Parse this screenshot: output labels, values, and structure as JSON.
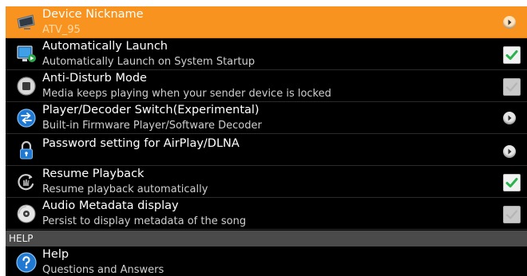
{
  "accent_color": "#f7931e",
  "settings": [
    {
      "title": "Device Nickname",
      "subtitle": "ATV_95",
      "icon": "tv-device-icon",
      "control": "chevron",
      "selected": true
    },
    {
      "title": "Automatically Launch",
      "subtitle": "Automatically Launch on System Startup",
      "icon": "monitor-launch-icon",
      "control": "checkbox",
      "checked": true
    },
    {
      "title": "Anti-Disturb Mode",
      "subtitle": "Media keeps playing when your sender device is locked",
      "icon": "stop-button-icon",
      "control": "checkbox",
      "checked": false
    },
    {
      "title": "Player/Decoder Switch(Experimental)",
      "subtitle": "Built-in Firmware Player/Software Decoder",
      "icon": "switch-arrows-icon",
      "control": "chevron"
    },
    {
      "title": "Password setting for AirPlay/DLNA",
      "subtitle": "",
      "icon": "lock-icon",
      "control": "chevron"
    },
    {
      "title": "Resume Playback",
      "subtitle": "Resume playback automatically",
      "icon": "resume-hand-icon",
      "control": "checkbox",
      "checked": true
    },
    {
      "title": "Audio Metadata display",
      "subtitle": "Persist to display metadata of the song",
      "icon": "disc-icon",
      "control": "checkbox",
      "checked": false
    }
  ],
  "help_section": {
    "header": "HELP",
    "title": "Help",
    "subtitle": "Questions and Answers",
    "icon": "help-question-icon"
  }
}
